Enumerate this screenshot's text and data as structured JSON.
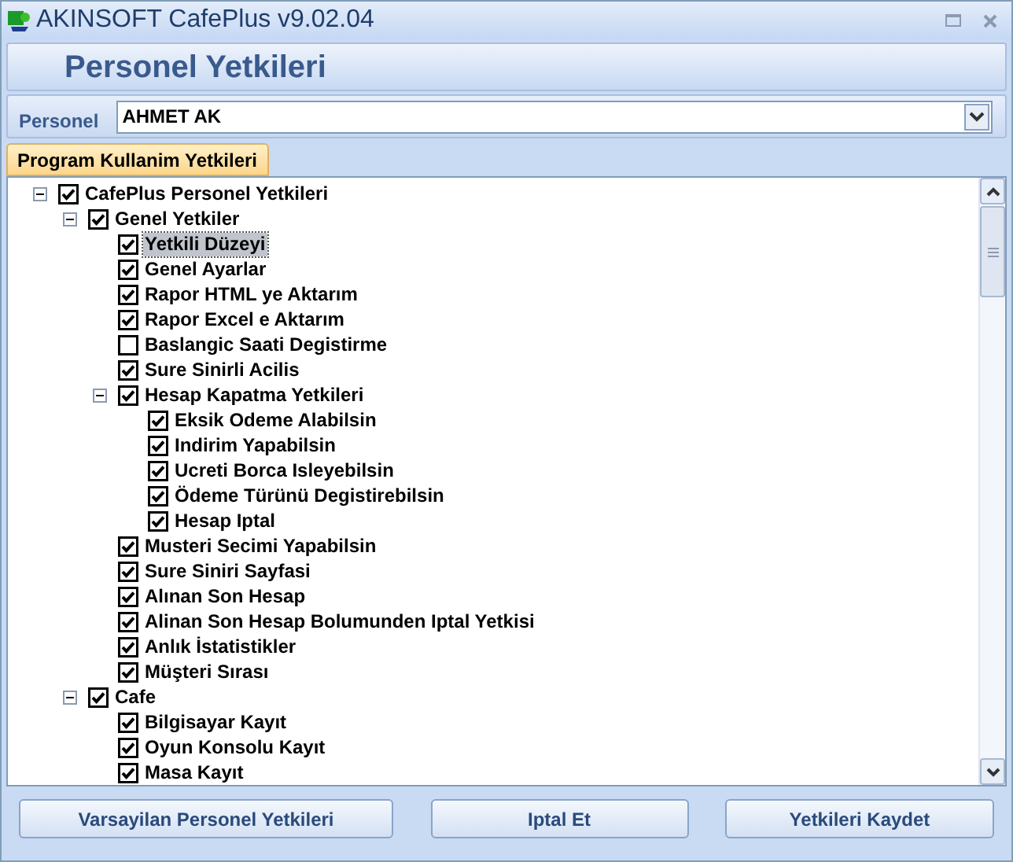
{
  "window": {
    "title": "AKINSOFT CafePlus v9.02.04"
  },
  "header": {
    "title": "Personel Yetkileri"
  },
  "personel": {
    "label": "Personel",
    "value": "AHMET AK"
  },
  "tabs": [
    {
      "label": "Program Kullanim Yetkileri",
      "selected": true
    }
  ],
  "tree": [
    {
      "label": "CafePlus Personel Yetkileri",
      "checked": true,
      "selected": false,
      "expanded": true,
      "children": [
        {
          "label": "Genel Yetkiler",
          "checked": true,
          "selected": false,
          "expanded": true,
          "children": [
            {
              "label": "Yetkili Düzeyi",
              "checked": true,
              "selected": true
            },
            {
              "label": "Genel Ayarlar",
              "checked": true,
              "selected": false
            },
            {
              "label": "Rapor HTML ye Aktarım",
              "checked": true,
              "selected": false
            },
            {
              "label": "Rapor Excel e Aktarım",
              "checked": true,
              "selected": false
            },
            {
              "label": "Baslangic Saati Degistirme",
              "checked": false,
              "selected": false
            },
            {
              "label": "Sure Sinirli Acilis",
              "checked": true,
              "selected": false
            },
            {
              "label": "Hesap Kapatma Yetkileri",
              "checked": true,
              "selected": false,
              "expanded": true,
              "children": [
                {
                  "label": "Eksik Odeme Alabilsin",
                  "checked": true,
                  "selected": false
                },
                {
                  "label": "Indirim Yapabilsin",
                  "checked": true,
                  "selected": false
                },
                {
                  "label": "Ucreti Borca Isleyebilsin",
                  "checked": true,
                  "selected": false
                },
                {
                  "label": "Ödeme Türünü Degistirebilsin",
                  "checked": true,
                  "selected": false
                },
                {
                  "label": "Hesap Iptal",
                  "checked": true,
                  "selected": false
                }
              ]
            },
            {
              "label": "Musteri Secimi Yapabilsin",
              "checked": true,
              "selected": false
            },
            {
              "label": "Sure Siniri Sayfasi",
              "checked": true,
              "selected": false
            },
            {
              "label": "Alınan Son Hesap",
              "checked": true,
              "selected": false
            },
            {
              "label": "Alinan Son Hesap Bolumunden Iptal Yetkisi",
              "checked": true,
              "selected": false
            },
            {
              "label": "Anlık İstatistikler",
              "checked": true,
              "selected": false
            },
            {
              "label": "Müşteri Sırası",
              "checked": true,
              "selected": false
            }
          ]
        },
        {
          "label": "Cafe",
          "checked": true,
          "selected": false,
          "expanded": true,
          "children": [
            {
              "label": "Bilgisayar Kayıt",
              "checked": true,
              "selected": false
            },
            {
              "label": "Oyun Konsolu Kayıt",
              "checked": true,
              "selected": false
            },
            {
              "label": "Masa Kayıt",
              "checked": true,
              "selected": false
            }
          ]
        }
      ]
    }
  ],
  "buttons": [
    "Varsayilan Personel Yetkileri",
    "Iptal Et",
    "Yetkileri Kaydet"
  ]
}
